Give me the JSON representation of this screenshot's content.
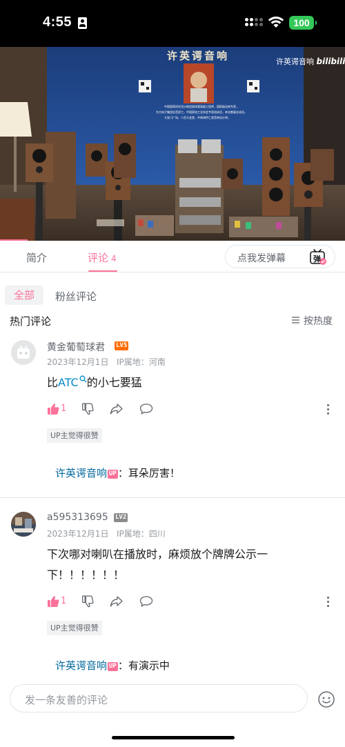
{
  "status_bar": {
    "time": "4:55",
    "battery": "100"
  },
  "video": {
    "banner_title": "许英谔音响",
    "watermark": "许英谔音响",
    "watermark_logo": "bilibili",
    "poster_lines": [
      "中国国家研究设计制造胆体管高级工程师，国家级动效专家，",
      "东方电子集团总音质工，中国家电工业协会专家组成员，亲业都展业成员。",
      "大安门广场，人民大会堂，中南海怀仁堂音响设计师。"
    ]
  },
  "tabs": {
    "intro": "简介",
    "comments": "评论",
    "comments_count": "4",
    "danmaku_placeholder": "点我发弹幕",
    "danmaku_icon_char": "弹"
  },
  "filter": {
    "all": "全部",
    "fans": "粉丝评论"
  },
  "section": {
    "hot_title": "热门评论",
    "sort_label": "按热度"
  },
  "comments": [
    {
      "username": "黄金葡萄球君",
      "level": "LV5",
      "date": "2023年12月1日",
      "ip": "IP属地：河南",
      "text_before": "比",
      "text_link": "ATC",
      "text_after": "的小七要猛",
      "likes": "1",
      "up_liked": "UP主觉得很赞",
      "reply_name": "许英谔音响",
      "reply_tag": "UP",
      "reply_text": "：耳朵厉害！"
    },
    {
      "username": "a595313695",
      "level": "LV2",
      "date": "2023年12月1日",
      "ip": "IP属地：四川",
      "text_line1": "下次哪对喇叭在播放时，麻烦放个牌牌公示一",
      "text_line2": "下！！！！！！",
      "likes": "1",
      "up_liked": "UP主觉得很赞",
      "reply_name": "许英谔音响",
      "reply_tag": "UP",
      "reply_text": "：有演示中"
    }
  ],
  "bottom": {
    "placeholder": "发一条友善的评论"
  },
  "colors": {
    "accent": "#fb7299",
    "link": "#008ac5",
    "reply_name": "#00699d",
    "level5": "#ff6c00",
    "level2": "#8b8b8b"
  }
}
